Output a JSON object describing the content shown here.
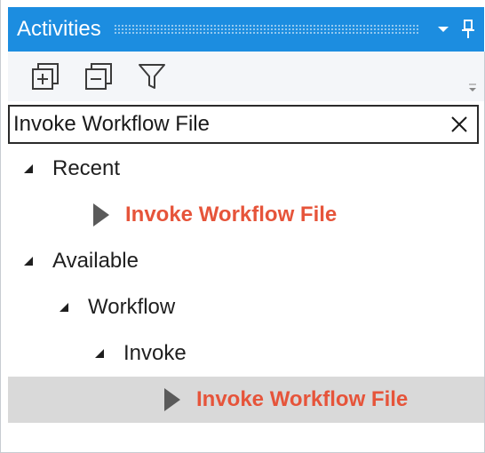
{
  "panel": {
    "title": "Activities",
    "title_bar_color": "#1c8de0"
  },
  "toolbar": {
    "expand_all_icon": "expand-all-icon",
    "collapse_all_icon": "collapse-all-icon",
    "filter_icon": "filter-icon"
  },
  "search": {
    "value": "Invoke Workflow File",
    "clear_icon": "close-icon"
  },
  "tree": {
    "recent": {
      "label": "Recent",
      "items": [
        {
          "label": "Invoke Workflow File"
        }
      ]
    },
    "available": {
      "label": "Available",
      "workflow": {
        "label": "Workflow",
        "invoke": {
          "label": "Invoke",
          "items": [
            {
              "label": "Invoke Workflow File",
              "selected": true
            }
          ]
        }
      }
    }
  },
  "colors": {
    "accent": "#1c8de0",
    "activity_text": "#e6543a",
    "selection": "#d9d9d9"
  }
}
